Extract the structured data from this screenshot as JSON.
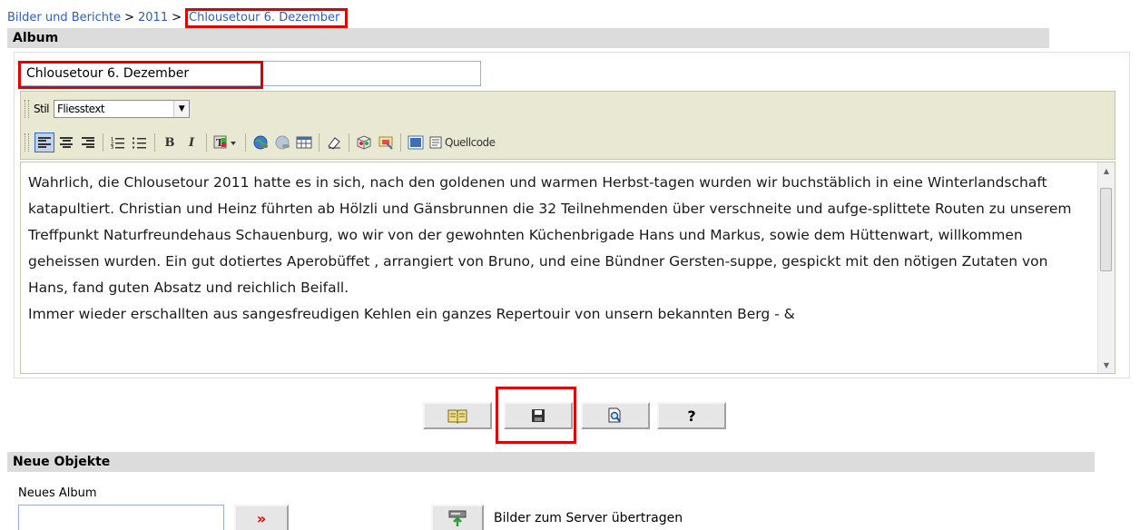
{
  "breadcrumb": {
    "items": [
      "Bilder und Berichte",
      "2011"
    ],
    "separator": ">",
    "current": "Chlousetour 6. Dezember"
  },
  "album": {
    "section_title": "Album",
    "title_value": "Chlousetour 6. Dezember"
  },
  "toolbar": {
    "style_label": "Stil",
    "style_value": "Fliesstext",
    "source_label": "Quellcode"
  },
  "editor": {
    "paragraphs": [
      "Wahrlich, die Chlousetour 2011 hatte es in sich, nach den goldenen und warmen Herbst-tagen wurden wir buchstäblich in eine Winterlandschaft katapultiert. Christian und Heinz führten  ab Hölzli und Gänsbrunnen die 32 Teilnehmenden über verschneite und aufge-splittete  Routen zu unserem Treffpunkt Naturfreundehaus Schauenburg, wo wir von der gewohnten Küchenbrigade Hans und Markus, sowie dem Hüttenwart, willkommen geheissen wurden. Ein gut dotiertes Aperobüffet , arrangiert von Bruno, und eine Bündner Gersten-suppe, gespickt mit den nötigen Zutaten von Hans, fand guten Absatz und reichlich Beifall.",
      "Immer wieder erschallten aus sangesfreudigen Kehlen ein ganzes Repertouir von unsern bekannten Berg - &"
    ]
  },
  "actions": {
    "help_label": "?"
  },
  "neue_objekte": {
    "section_title": "Neue Objekte",
    "new_album_label": "Neues Album",
    "new_album_value": "",
    "go_label": "»",
    "upload_label": "Bilder zum Server übertragen"
  },
  "colors": {
    "highlight": "#e00000",
    "link": "#2f5fbf",
    "section_bar": "#dcdcdc",
    "toolbar_bg": "#e9e8d3"
  }
}
